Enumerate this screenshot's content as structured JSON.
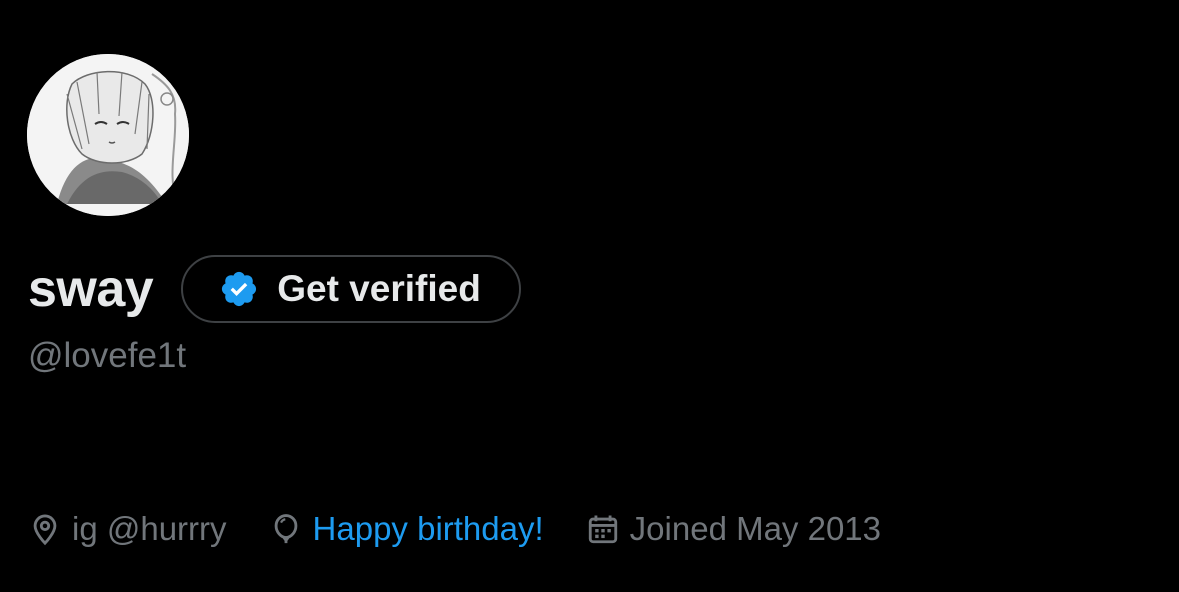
{
  "profile": {
    "avatar_icon": "profile-avatar-image",
    "display_name": "sway",
    "handle": "@lovefe1t"
  },
  "verify_button": {
    "icon": "verified-badge-icon",
    "label": "Get verified",
    "badge_color": "#1d9bf0"
  },
  "meta": {
    "location": {
      "icon": "location-pin-icon",
      "text": "ig @hurrry"
    },
    "birthday": {
      "icon": "balloon-icon",
      "text": "Happy birthday!",
      "color": "#1d9bf0"
    },
    "joined": {
      "icon": "calendar-icon",
      "text": "Joined May 2013"
    }
  },
  "colors": {
    "background": "#000000",
    "primary_text": "#e7e9ea",
    "secondary_text": "#71767b",
    "accent": "#1d9bf0"
  }
}
